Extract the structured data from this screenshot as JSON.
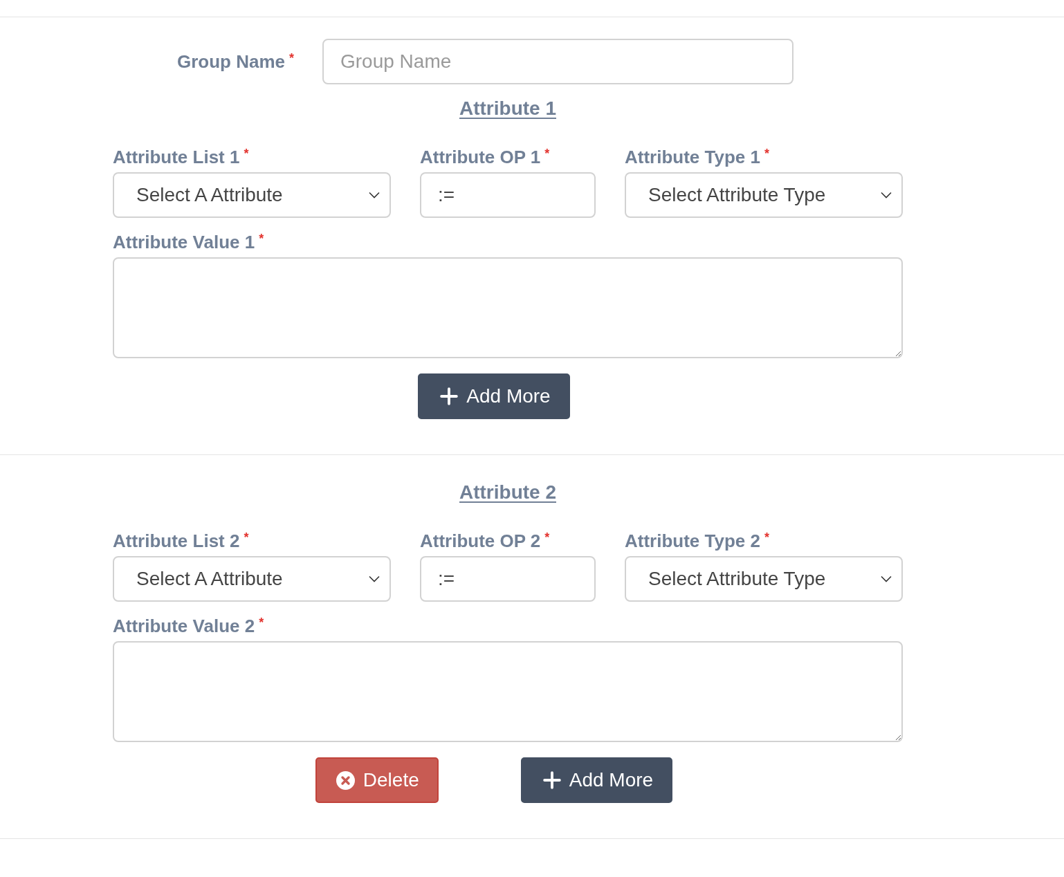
{
  "group_name": {
    "label": "Group Name",
    "required_mark": "*",
    "placeholder": "Group Name"
  },
  "attributes": [
    {
      "heading": "Attribute 1",
      "fields": [
        {
          "kind": "select",
          "label": "Attribute List 1",
          "required_mark": "*",
          "value": "Select A Attribute"
        },
        {
          "kind": "input",
          "label": "Attribute OP 1",
          "required_mark": "*",
          "value": ":="
        },
        {
          "kind": "select",
          "label": "Attribute Type 1",
          "required_mark": "*",
          "value": "Select Attribute Type"
        }
      ],
      "value_field": {
        "label": "Attribute Value 1",
        "required_mark": "*"
      },
      "buttons": [
        {
          "kind": "add",
          "label": "Add More"
        }
      ]
    },
    {
      "heading": "Attribute 2",
      "fields": [
        {
          "kind": "select",
          "label": "Attribute List 2",
          "required_mark": "*",
          "value": "Select A Attribute"
        },
        {
          "kind": "input",
          "label": "Attribute OP 2",
          "required_mark": "*",
          "value": ":="
        },
        {
          "kind": "select",
          "label": "Attribute Type 2",
          "required_mark": "*",
          "value": "Select Attribute Type"
        }
      ],
      "value_field": {
        "label": "Attribute Value 2",
        "required_mark": "*"
      },
      "buttons": [
        {
          "kind": "delete",
          "label": "Delete"
        },
        {
          "kind": "add",
          "label": "Add More"
        }
      ]
    }
  ]
}
